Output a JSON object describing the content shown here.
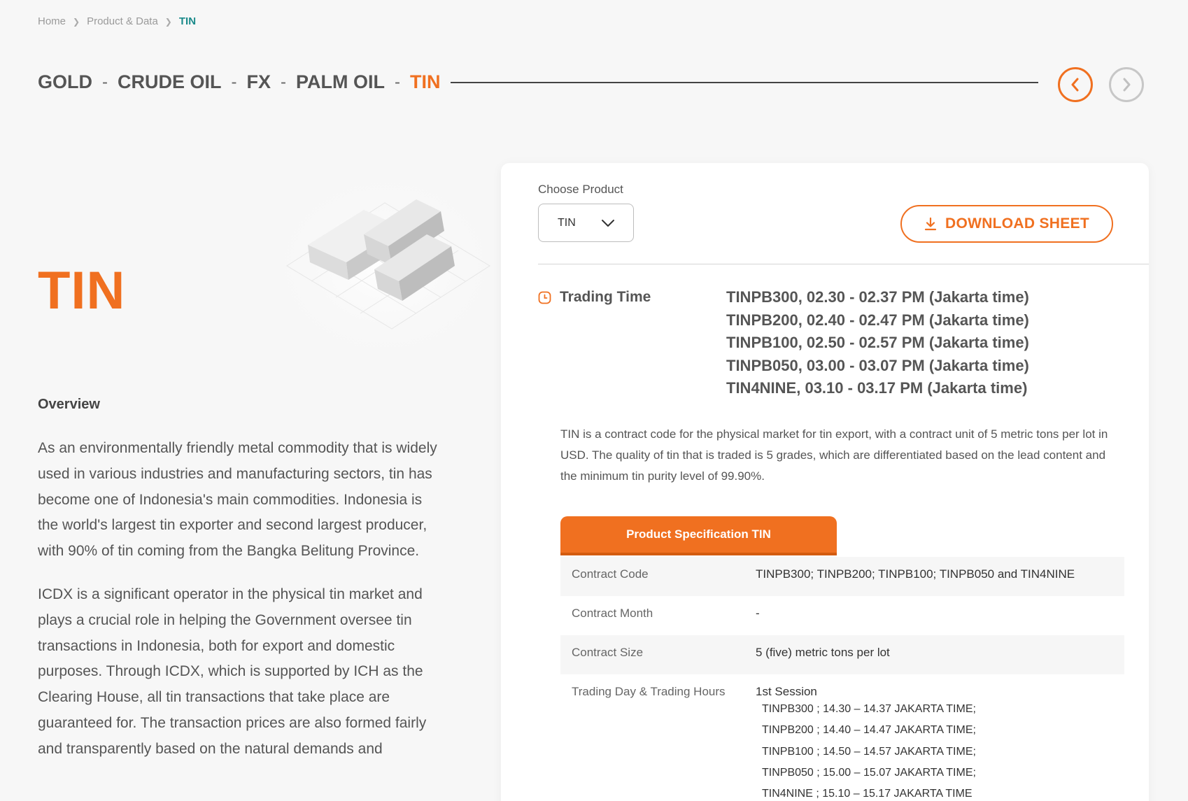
{
  "breadcrumb": {
    "items": [
      "Home",
      "Product & Data"
    ],
    "current": "TIN"
  },
  "product_nav": {
    "items": [
      "GOLD",
      "CRUDE OIL",
      "FX",
      "PALM OIL"
    ],
    "active": "TIN"
  },
  "hero": {
    "title": "TIN"
  },
  "overview": {
    "heading": "Overview",
    "paragraph1": "As an environmentally friendly metal commodity that is widely used in various industries and manufacturing sectors, tin has become one of Indonesia's main commodities. Indonesia is the world's largest tin exporter and second largest producer, with 90% of tin coming from the Bangka Belitung Province.",
    "paragraph2": "ICDX is a significant operator in the physical tin market and plays a crucial role in helping the Government oversee tin transactions in Indonesia, both for export and domestic purposes. Through ICDX, which is supported by ICH as the Clearing House, all tin transactions that take place are guaranteed for. The transaction prices are also formed fairly and transparently based on the natural demands and"
  },
  "panel": {
    "choose_label": "Choose Product",
    "selected_product": "TIN",
    "download_label": "DOWNLOAD SHEET",
    "trading_time_label": "Trading Time",
    "trading_times": [
      "TINPB300, 02.30 - 02.37 PM (Jakarta time)",
      "TINPB200, 02.40 - 02.47 PM (Jakarta time)",
      "TINPB100, 02.50 - 02.57 PM (Jakarta time)",
      "TINPB050, 03.00 - 03.07 PM (Jakarta time)",
      "TIN4NINE, 03.10 - 03.17 PM (Jakarta time)"
    ],
    "description": "TIN is a contract code for the physical market for tin export, with a contract unit of 5 metric tons per lot in USD. The quality of tin that is traded is 5 grades, which are differentiated based on the lead content and the minimum tin purity level of 99.90%.",
    "spec_tab": "Product Specification TIN",
    "spec": {
      "contract_code_label": "Contract Code",
      "contract_code_value": "TINPB300; TINPB200; TINPB100; TINPB050 and TIN4NINE",
      "contract_month_label": "Contract Month",
      "contract_month_value": "-",
      "contract_size_label": "Contract Size",
      "contract_size_value": "5 (five) metric tons per lot",
      "trading_day_label": "Trading Day & Trading Hours",
      "session_title": "1st Session",
      "sessions": [
        "TINPB300 ; 14.30 – 14.37 JAKARTA TIME;",
        "TINPB200 ; 14.40 – 14.47 JAKARTA TIME;",
        "TINPB100 ; 14.50 – 14.57 JAKARTA TIME;",
        "TINPB050 ; 15.00 – 15.07 JAKARTA TIME;",
        "TIN4NINE ; 15.10 – 15.17 JAKARTA TIME"
      ]
    }
  },
  "colors": {
    "accent": "#f07020",
    "breadcrumb_current": "#1a8a8a",
    "background": "#f7f7f7"
  },
  "icons": [
    "chevron-right-icon",
    "chevron-left-icon",
    "chevron-down-icon",
    "download-icon",
    "clock-icon"
  ]
}
